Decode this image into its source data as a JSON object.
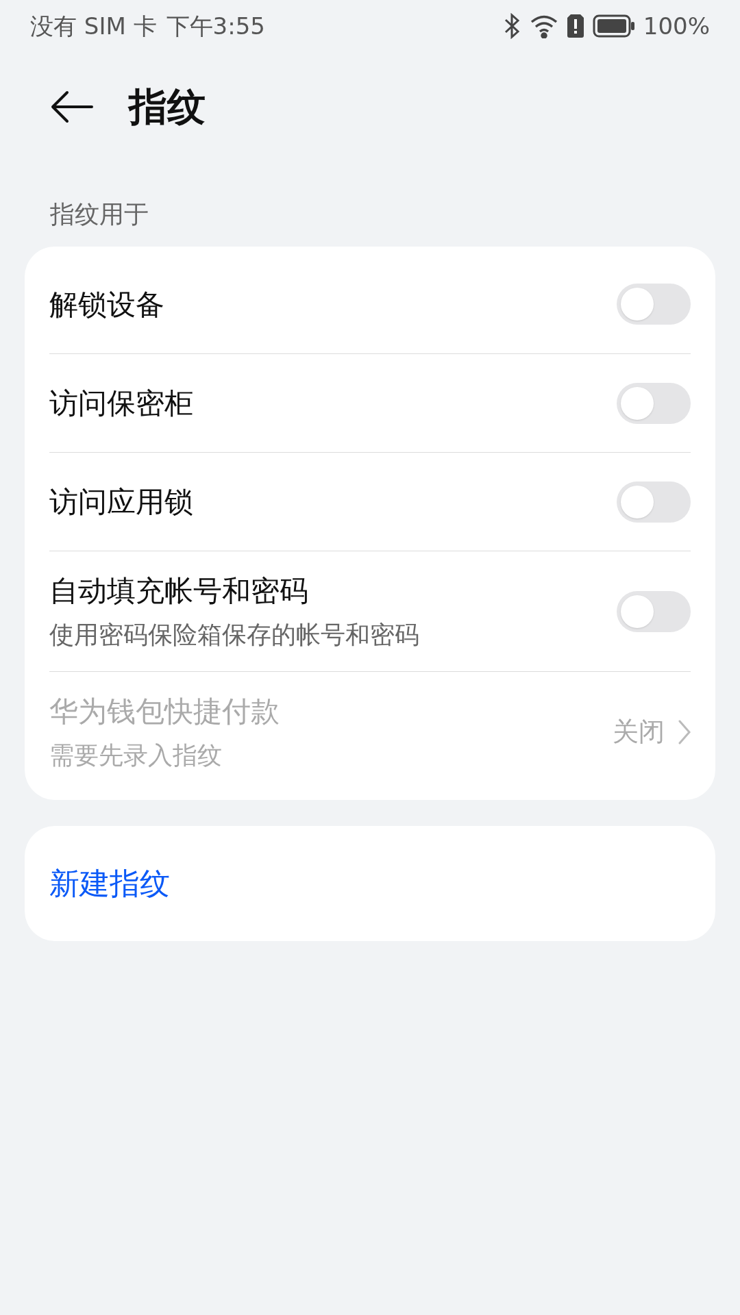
{
  "status_bar": {
    "carrier": "没有 SIM 卡",
    "time": "下午3:55",
    "battery": "100%"
  },
  "header": {
    "title": "指纹"
  },
  "section": {
    "label": "指纹用于",
    "items": [
      {
        "kind": "toggle",
        "title": "解锁设备",
        "on": false,
        "disabled": false
      },
      {
        "kind": "toggle",
        "title": "访问保密柜",
        "on": false,
        "disabled": false
      },
      {
        "kind": "toggle",
        "title": "访问应用锁",
        "on": false,
        "disabled": false
      },
      {
        "kind": "toggle",
        "title": "自动填充帐号和密码",
        "subtitle": "使用密码保险箱保存的帐号和密码",
        "on": false,
        "disabled": false
      },
      {
        "kind": "link",
        "title": "华为钱包快捷付款",
        "subtitle": "需要先录入指纹",
        "value": "关闭",
        "disabled": true
      }
    ]
  },
  "action": {
    "label": "新建指纹"
  }
}
